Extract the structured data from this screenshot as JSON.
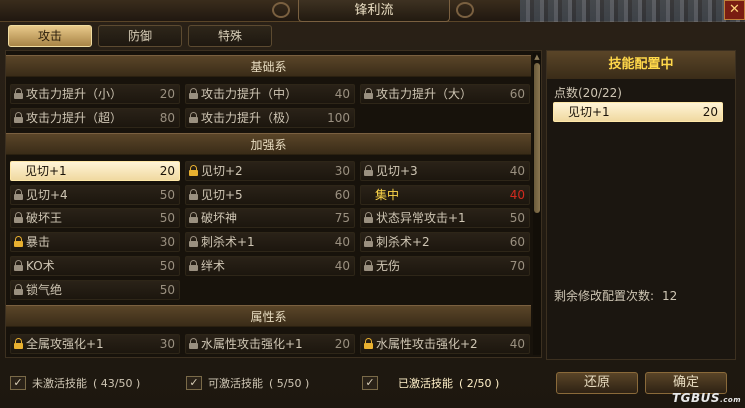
{
  "window": {
    "title": "锋利流"
  },
  "tabs": [
    {
      "label": "攻击",
      "active": true
    },
    {
      "label": "防御",
      "active": false
    },
    {
      "label": "特殊",
      "active": false
    }
  ],
  "sections": {
    "basic": {
      "title": "基础系"
    },
    "enhance": {
      "title": "加强系"
    },
    "attribute": {
      "title": "属性系"
    }
  },
  "skills": [
    {
      "name": "攻击力提升（小）",
      "value": "20",
      "lock": "grey"
    },
    {
      "name": "攻击力提升（中）",
      "value": "40",
      "lock": "grey"
    },
    {
      "name": "攻击力提升（大）",
      "value": "60",
      "lock": "grey"
    },
    {
      "name": "攻击力提升（超）",
      "value": "80",
      "lock": "grey"
    },
    {
      "name": "攻击力提升（极）",
      "value": "100",
      "lock": "grey"
    },
    {
      "name": "见切+1",
      "value": "20",
      "lock": "none",
      "state": "selected"
    },
    {
      "name": "见切+2",
      "value": "30",
      "lock": "gold"
    },
    {
      "name": "见切+3",
      "value": "40",
      "lock": "grey"
    },
    {
      "name": "见切+4",
      "value": "50",
      "lock": "grey"
    },
    {
      "name": "见切+5",
      "value": "60",
      "lock": "grey"
    },
    {
      "name": "集中",
      "value": "40",
      "lock": "none",
      "state": "highlight"
    },
    {
      "name": "破坏王",
      "value": "50",
      "lock": "grey"
    },
    {
      "name": "破坏神",
      "value": "75",
      "lock": "grey"
    },
    {
      "name": "状态异常攻击+1",
      "value": "50",
      "lock": "grey"
    },
    {
      "name": "暴击",
      "value": "30",
      "lock": "gold"
    },
    {
      "name": "刺杀术+1",
      "value": "40",
      "lock": "grey"
    },
    {
      "name": "刺杀术+2",
      "value": "60",
      "lock": "grey"
    },
    {
      "name": "KO术",
      "value": "50",
      "lock": "grey"
    },
    {
      "name": "绊术",
      "value": "40",
      "lock": "grey"
    },
    {
      "name": "无伤",
      "value": "70",
      "lock": "grey"
    },
    {
      "name": "锁气绝",
      "value": "50",
      "lock": "grey"
    },
    {
      "name": "全属攻强化+1",
      "value": "30",
      "lock": "gold"
    },
    {
      "name": "水属性攻击强化+1",
      "value": "20",
      "lock": "grey"
    },
    {
      "name": "水属性攻击强化+2",
      "value": "40",
      "lock": "gold"
    }
  ],
  "config": {
    "title": "技能配置中",
    "points": "点数(20/22)",
    "items": [
      {
        "name": "见切+1",
        "value": "20"
      }
    ],
    "remaining_label": "剩余修改配置次数:",
    "remaining_value": "12"
  },
  "legend": [
    {
      "label": "未激活技能",
      "count": "( 43/50 )"
    },
    {
      "label": "可激活技能",
      "count": "( 5/50 )"
    },
    {
      "label": "已激活技能",
      "count": "( 2/50 )"
    }
  ],
  "buttons": {
    "reset": "还原",
    "ok": "确定"
  },
  "watermark": {
    "main": "TGBUS",
    "suffix": ".com"
  },
  "colors": {
    "accent_gold": "#ffd84a",
    "selected_bg": "#f5e3b4",
    "highlight_value": "#d22a1e",
    "lock_gold": "#e8b030",
    "lock_grey": "#9a9080"
  }
}
